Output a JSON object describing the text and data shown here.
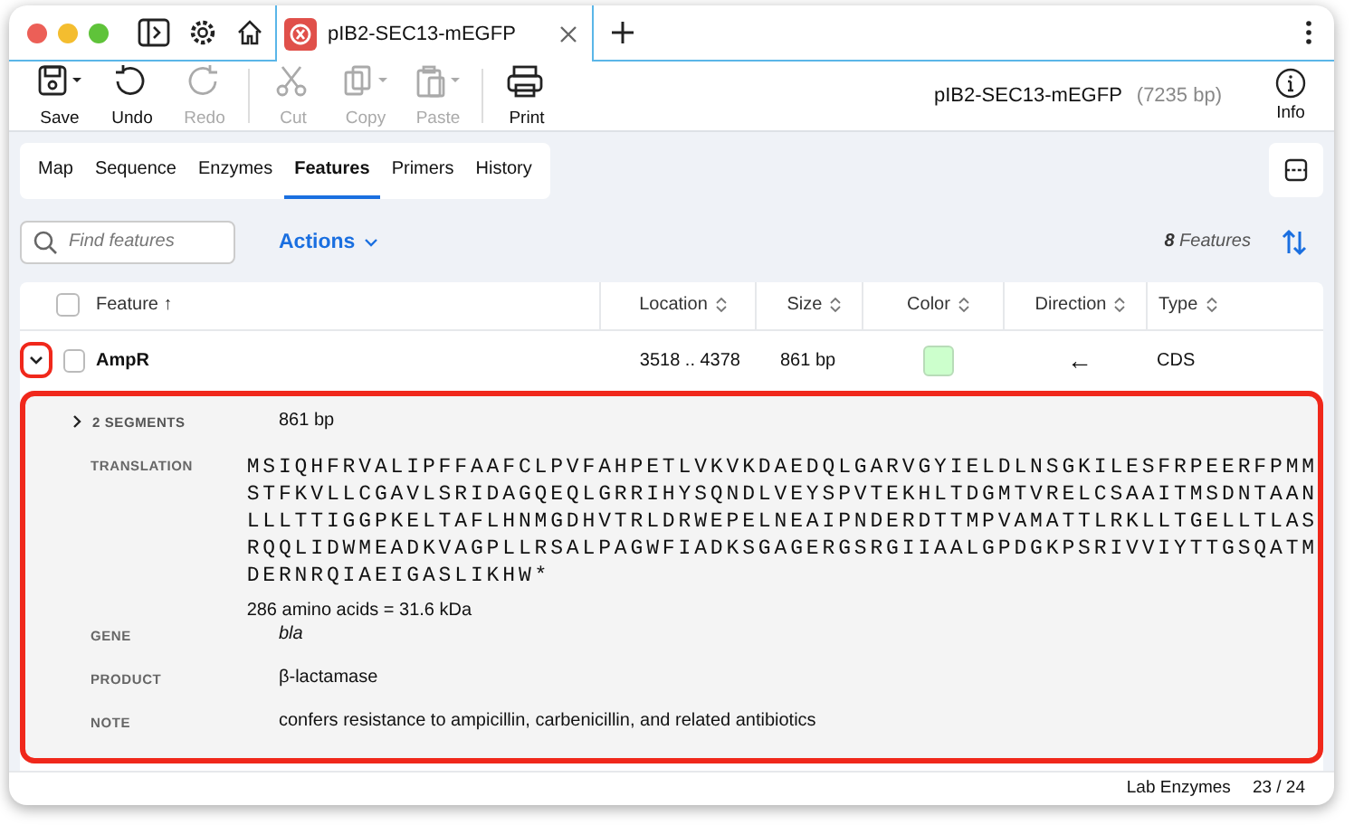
{
  "tab": {
    "title": "pIB2-SEC13-mEGFP",
    "selected": true
  },
  "toolbar": {
    "groups": [
      {
        "buttons": [
          {
            "kind": "save",
            "label": "Save",
            "disabled": false,
            "dropdown": true
          },
          {
            "kind": "undo",
            "label": "Undo",
            "disabled": false,
            "dropdown": false
          },
          {
            "kind": "redo",
            "label": "Redo",
            "disabled": true,
            "dropdown": false
          }
        ]
      },
      {
        "buttons": [
          {
            "kind": "cut",
            "label": "Cut",
            "disabled": true,
            "dropdown": false
          },
          {
            "kind": "copy",
            "label": "Copy",
            "disabled": true,
            "dropdown": true
          },
          {
            "kind": "paste",
            "label": "Paste",
            "disabled": true,
            "dropdown": true
          }
        ]
      },
      {
        "buttons": [
          {
            "kind": "print",
            "label": "Print",
            "disabled": false,
            "dropdown": false
          }
        ]
      }
    ],
    "document": "pIB2-SEC13-mEGFP",
    "length": "(7235 bp)",
    "info": "Info"
  },
  "view_tabs": [
    {
      "label": "Map",
      "selected": false
    },
    {
      "label": "Sequence",
      "selected": false
    },
    {
      "label": "Enzymes",
      "selected": false
    },
    {
      "label": "Features",
      "selected": true
    },
    {
      "label": "Primers",
      "selected": false
    },
    {
      "label": "History",
      "selected": false
    }
  ],
  "search": {
    "placeholder": "Find features"
  },
  "actions": "Actions",
  "count": {
    "number": "8",
    "label": "Features"
  },
  "table": {
    "select_all_checked": false,
    "columns": [
      {
        "label": "Feature ↑",
        "sorted": true
      },
      {
        "label": "Location",
        "sorted": false
      },
      {
        "label": "Size",
        "sorted": false
      },
      {
        "label": "Color",
        "sorted": false
      },
      {
        "label": "Direction",
        "sorted": false
      },
      {
        "label": "Type",
        "sorted": false
      }
    ],
    "rows": [
      {
        "name": "AmpR",
        "location": "3518 .. 4378",
        "size": "861 bp",
        "color": "#ccffcc",
        "direction": "←",
        "type": "CDS",
        "checked": false,
        "expanded": true,
        "details": {
          "segments": {
            "label": "2 SEGMENTS",
            "value": "861 bp",
            "expanded": false
          },
          "translation": {
            "label": "TRANSLATION",
            "lines": [
              "MSIQHFRVALIPFFAAFCLPVFAHPETLVKVKDAEDQLGARVGYIELDLNSGKILESFRPEERFPMM",
              "STFKVLLCGAVLSRIDAGQEQLGRRIHYSQNDLVEYSPVTEKHLTDGMTVRELCSAAITMSDNTAAN",
              "LLLTTIGGPKELTAFLHNMGDHVTRLDRWEPELNEAIPNDERDTTMPVAMATTLRKLLTGELLTLAS",
              "RQQLIDWMEADKVAGPLLRSALPAGWFIADKSGAGERGSRGIIAALGPDGKPSRIVVIYTTGSQATM",
              "DERNRQIAEIGASLIKHW*"
            ],
            "summary": "286 amino acids = 31.6 kDa"
          },
          "qualifiers": [
            {
              "label": "GENE",
              "value": "bla",
              "italic": true
            },
            {
              "label": "PRODUCT",
              "value": "β-lactamase",
              "italic": false
            },
            {
              "label": "NOTE",
              "value": "confers resistance to ampicillin, carbenicillin, and related antibiotics",
              "italic": false
            }
          ]
        }
      }
    ]
  },
  "status_bar": {
    "enzymes": "Lab Enzymes",
    "page": "23 / 24"
  }
}
